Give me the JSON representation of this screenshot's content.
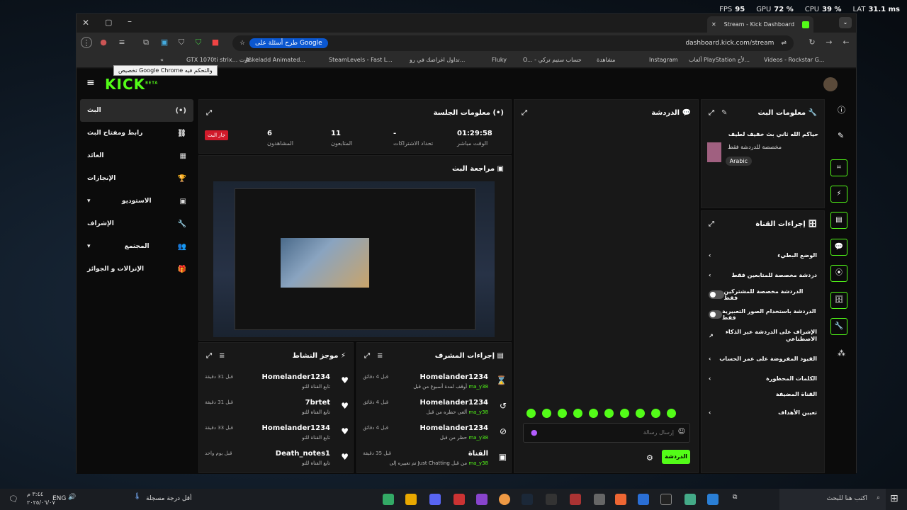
{
  "perf": {
    "fps_label": "FPS",
    "fps": "95",
    "gpu_label": "GPU",
    "gpu": "72 %",
    "cpu_label": "CPU",
    "cpu": "39 %",
    "lat_label": "LAT",
    "lat": "31.1 ms"
  },
  "browser": {
    "tab_title": "Stream - Kick Dashboard",
    "url": "dashboard.kick.com/stream",
    "ask_google": "طرح أسئلة على Google",
    "tooltip": "تخصيص Google Chrome والتحكم فيه",
    "bookmarks": [
      "GTX 1070ti strix... كرت",
      "Askeladd Animated...",
      "SteamLevels - Fast L...",
      "تداول اغراضك في رو...",
      "Fluky",
      "O... - حساب ستيم تركي",
      "مشاهدة",
      "Instagram",
      "ألعاب PlayStation لأج...",
      "Videos - Rockstar G..."
    ]
  },
  "app": {
    "logo": "KICK",
    "logo_sup": "BETA",
    "nav": [
      {
        "label": "البث",
        "icon": "(•)"
      },
      {
        "label": "رابط ومفتاح البث",
        "icon": "⛓"
      },
      {
        "label": "العائد",
        "icon": "▦"
      },
      {
        "label": "الإنجازات",
        "icon": "🏆"
      },
      {
        "label": "الاستوديو",
        "icon": "▣"
      },
      {
        "label": "الإشراف",
        "icon": "🔧"
      },
      {
        "label": "المجتمع",
        "icon": "👥"
      },
      {
        "label": "الإنزالات و الجوائز",
        "icon": "🎁"
      }
    ],
    "session": {
      "title": "معلومات الجلسة",
      "live_badge": "جار البث",
      "stats": [
        {
          "value": "01:29:58",
          "label": "الوقت مباشر"
        },
        {
          "value": "-",
          "label": "تحداد الاشتراكات"
        },
        {
          "value": "11",
          "label": "المتابعون"
        },
        {
          "value": "6",
          "label": "المشاهدون"
        }
      ]
    },
    "preview_title": "مراجعة البث",
    "chat": {
      "title": "الدردشة",
      "placeholder": "إرسال رسالة",
      "send": "الدردشة"
    },
    "stream_info": {
      "title": "معلومات البث",
      "stream_title": "حياكم الله ثاني بث خفيف لطيف",
      "category": "مخصصة للدردشة فقط",
      "language": "Arabic"
    },
    "channel_actions": {
      "title": "إجراءات القناة",
      "items": [
        {
          "label": "الوضع البطيء",
          "type": "chevron"
        },
        {
          "label": "دردشة مخصصة للمتابعين فقط",
          "type": "chevron"
        },
        {
          "label": "الدردشة مخصصة للمشتركين فقط",
          "type": "toggle"
        },
        {
          "label": "الدردشة باستخدام الصور التعبيرية فقط",
          "type": "toggle"
        },
        {
          "label": "الإشراف على الدردشة عبر الذكاء الاصطناعي",
          "type": "external"
        },
        {
          "label": "القيود المفروضة على عمر الحساب",
          "type": "chevron"
        },
        {
          "label": "الكلمات المحظورة",
          "type": "chevron"
        }
      ],
      "section": "القناة المضيفة",
      "host_item": "تعيين الأهداف"
    },
    "mod_actions": {
      "title": "إجراءات المشرف",
      "rows": [
        {
          "name": "Homelander1234",
          "sub": "أوقف لمدة أسبوع من قبل",
          "mod": "ma_y38",
          "time": "قبل 4 دقائق",
          "sym": "⌛"
        },
        {
          "name": "Homelander1234",
          "sub": "ألغي حظره من قبل",
          "mod": "ma_y38",
          "time": "قبل 4 دقائق",
          "sym": "↺"
        },
        {
          "name": "Homelander1234",
          "sub": "حظر من قبل",
          "mod": "ma_y38",
          "time": "قبل 4 دقائق",
          "sym": "⊘"
        },
        {
          "name": "القناة",
          "sub": "تم تغييره إلى Just Chatting من قبل",
          "mod": "ma_y38",
          "time": "قبل 35 دقيقة",
          "sym": "▣"
        }
      ]
    },
    "activity": {
      "title": "موجز النشاط",
      "rows": [
        {
          "name": "Homelander1234",
          "sub": "تابع القناة للتو",
          "time": "قبل 31 دقيقة"
        },
        {
          "name": "7brtet",
          "sub": "تابع القناة للتو",
          "time": "قبل 31 دقيقة"
        },
        {
          "name": "Homelander1234",
          "sub": "تابع القناة للتو",
          "time": "قبل 33 دقيقة"
        },
        {
          "name": "Death_notes1",
          "sub": "تابع القناة للتو",
          "time": "قبل يوم واحد"
        }
      ]
    }
  },
  "taskbar": {
    "search": "اكتب هنا للبحث",
    "weather": "أقل درجة مسجلة",
    "lang": "ENG",
    "time": "٣:٤٤ م",
    "date": "٢٠٢٥/٠٦/٠٧"
  }
}
